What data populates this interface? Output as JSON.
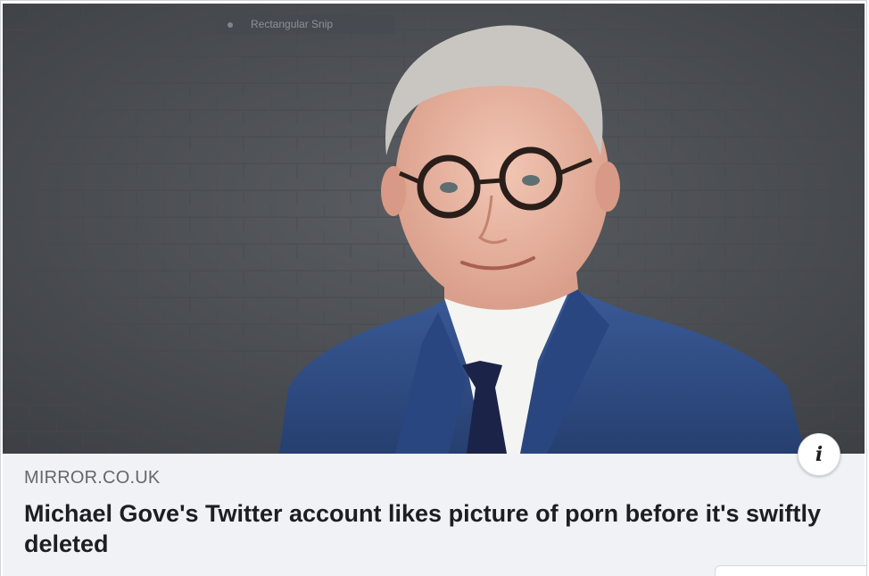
{
  "overlay": {
    "snip_label": "Rectangular Snip"
  },
  "link_preview": {
    "image": {
      "alt": "Michael Gove"
    },
    "info_icon_glyph": "i",
    "source": "MIRROR.CO.UK",
    "headline": "Michael Gove's Twitter account likes picture of porn before it's swiftly deleted"
  },
  "colors": {
    "meta_background": "#f0f2f5",
    "source_text": "#65676b",
    "headline_text": "#1c1e21",
    "suit": "#2f4d86",
    "wall": "#4a4d52"
  },
  "icons": {
    "info": "info-icon"
  }
}
